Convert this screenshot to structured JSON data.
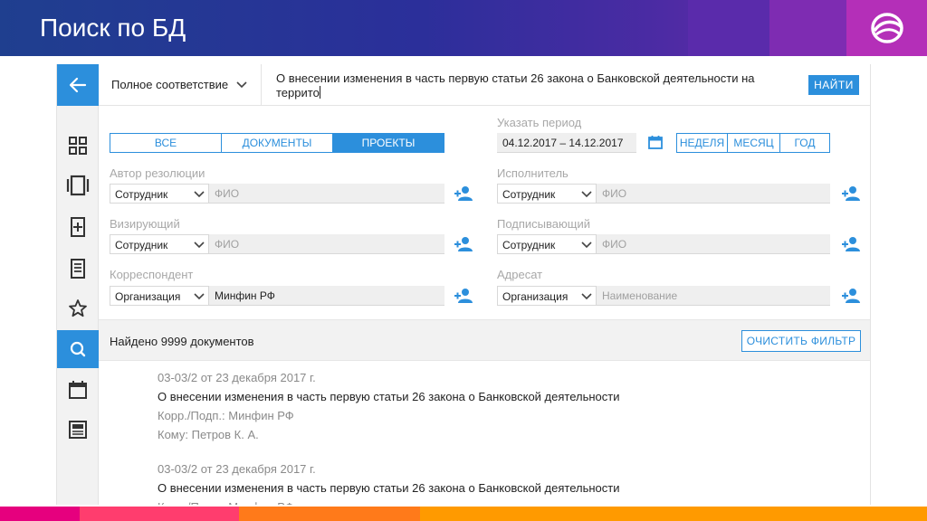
{
  "slide": {
    "title": "Поиск по БД",
    "colors": {
      "header_start": "#1f3f8f",
      "header_end": "#b42fb8",
      "accent": "#2c8fdc"
    }
  },
  "sidebar": {
    "back_icon": "arrow-left-icon",
    "items": [
      {
        "icon": "grid-icon"
      },
      {
        "icon": "documents-icon"
      },
      {
        "icon": "new-document-icon"
      },
      {
        "icon": "document-list-icon"
      },
      {
        "icon": "star-icon"
      },
      {
        "icon": "search-icon",
        "active": true
      },
      {
        "icon": "calendar-icon"
      },
      {
        "icon": "newspaper-icon"
      }
    ]
  },
  "search": {
    "match_mode": "Полное соответствие",
    "query_line1": "О внесении изменения в часть первую статьи 26 закона о Банковской деятельности на",
    "query_line2": "террито",
    "find_label": "НАЙТИ"
  },
  "tabs": [
    {
      "label": "ВСЕ",
      "active": false
    },
    {
      "label": "ДОКУМЕНТЫ",
      "active": false
    },
    {
      "label": "ПРОЕКТЫ",
      "active": true
    }
  ],
  "period": {
    "label": "Указать период",
    "value": "04.12.2017 – 14.12.2017",
    "options": [
      "НЕДЕЛЯ",
      "МЕСЯЦ",
      "ГОД"
    ]
  },
  "filters": {
    "author": {
      "label": "Автор резолюции",
      "type": "Сотрудник",
      "placeholder": "ФИО",
      "value": ""
    },
    "executor": {
      "label": "Исполнитель",
      "type": "Сотрудник",
      "placeholder": "ФИО",
      "value": ""
    },
    "visa": {
      "label": "Визирующий",
      "type": "Сотрудник",
      "placeholder": "ФИО",
      "value": ""
    },
    "signer": {
      "label": "Подписывающий",
      "type": "Сотрудник",
      "placeholder": "ФИО",
      "value": ""
    },
    "correspondent": {
      "label": "Корреспондент",
      "type": "Организация",
      "placeholder": "",
      "value": "Минфин РФ"
    },
    "addressee": {
      "label": "Адресат",
      "type": "Организация",
      "placeholder": "Наименование",
      "value": ""
    }
  },
  "results": {
    "found_text": "Найдено 9999 документов",
    "clear_label": "ОЧИСТИТЬ ФИЛЬТР",
    "items": [
      {
        "number": "03-03/2 от 23 декабря 2017 г.",
        "title": "О внесении изменения в часть первую статьи 26 закона о Банковской деятельности",
        "corr": "Корр./Подп.: Минфин РФ",
        "to": "Кому: Петров К. А."
      },
      {
        "number": "03-03/2 от 23 декабря 2017 г.",
        "title": "О внесении изменения в часть первую статьи 26 закона о Банковской деятельности",
        "corr": "Корр./Подп.: Минфин РФ",
        "to": ""
      }
    ]
  }
}
